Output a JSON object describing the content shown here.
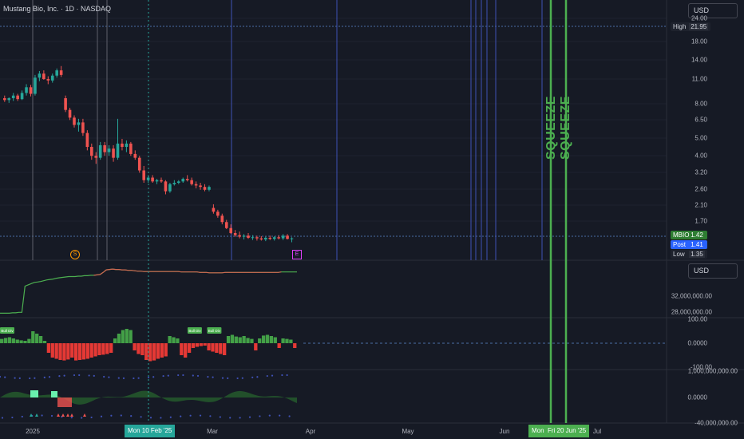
{
  "header": {
    "symbol_title": "Mustang Bio, Inc. · 1D · NASDAQ"
  },
  "currency": "USD",
  "price_axis": [
    "24.00",
    "18.00",
    "14.00",
    "11.00",
    "8.00",
    "6.50",
    "5.00",
    "4.00",
    "3.20",
    "2.60",
    "2.10",
    "1.70"
  ],
  "volume_axis": [
    "32,000,000.00",
    "28,000,000.00"
  ],
  "osc_axis": [
    "100.00",
    "0.0000",
    "-100.00"
  ],
  "osc2_axis": [
    "1,000,000,000.00",
    "0.0000",
    "-40,000,000.00"
  ],
  "tags": {
    "high": {
      "label": "High",
      "value": "21.95"
    },
    "symbol": {
      "label": "MBIO",
      "value": "1.42"
    },
    "post": {
      "label": "Post",
      "value": "1.41"
    },
    "low": {
      "label": "Low",
      "value": "1.35"
    }
  },
  "time_axis": [
    "2025",
    "Mar",
    "Apr",
    "May",
    "Jun",
    "Jul"
  ],
  "time_highlights": {
    "crosshair": "Mon 10 Feb '25",
    "mon": "Mon",
    "fri": "Fri 20 Jun '25"
  },
  "markers": {
    "dividend": "S",
    "earnings": "E"
  },
  "squeeze_labels": [
    "SQUEEZE",
    "SQUEEZE"
  ],
  "badges": [
    "Bull Div",
    "Bull Div",
    "Bull Div"
  ],
  "colors": {
    "bg": "#161a25",
    "up": "#26a69a",
    "down": "#ef5350",
    "squeeze": "#4caf50",
    "crosshair": "#26a69a",
    "tag_blue": "#2962ff"
  },
  "chart_data": {
    "type": "candlestick",
    "scale": "log",
    "ylim": [
      1.2,
      27
    ],
    "candles": [
      {
        "o": 8.6,
        "h": 8.9,
        "l": 8.2,
        "c": 8.4
      },
      {
        "o": 8.4,
        "h": 8.7,
        "l": 8.1,
        "c": 8.6
      },
      {
        "o": 8.6,
        "h": 9.2,
        "l": 8.3,
        "c": 8.9
      },
      {
        "o": 8.9,
        "h": 9.1,
        "l": 8.3,
        "c": 8.5
      },
      {
        "o": 8.5,
        "h": 9.5,
        "l": 8.4,
        "c": 9.2
      },
      {
        "o": 9.2,
        "h": 10.3,
        "l": 8.9,
        "c": 9.9
      },
      {
        "o": 9.9,
        "h": 10.2,
        "l": 8.8,
        "c": 9.1
      },
      {
        "o": 9.1,
        "h": 11.6,
        "l": 8.9,
        "c": 11.2
      },
      {
        "o": 11.2,
        "h": 12.2,
        "l": 10.7,
        "c": 11.8
      },
      {
        "o": 11.8,
        "h": 12.3,
        "l": 10.9,
        "c": 11.0
      },
      {
        "o": 11.0,
        "h": 11.4,
        "l": 10.3,
        "c": 10.8
      },
      {
        "o": 10.8,
        "h": 11.8,
        "l": 10.5,
        "c": 11.5
      },
      {
        "o": 11.5,
        "h": 12.6,
        "l": 11.2,
        "c": 12.3
      },
      {
        "o": 12.3,
        "h": 13.0,
        "l": 11.3,
        "c": 11.6
      },
      {
        "o": 8.6,
        "h": 8.9,
        "l": 7.2,
        "c": 7.4
      },
      {
        "o": 7.4,
        "h": 7.6,
        "l": 6.5,
        "c": 6.7
      },
      {
        "o": 6.7,
        "h": 6.9,
        "l": 5.9,
        "c": 6.1
      },
      {
        "o": 6.1,
        "h": 6.6,
        "l": 5.6,
        "c": 6.3
      },
      {
        "o": 6.3,
        "h": 6.6,
        "l": 5.3,
        "c": 5.5
      },
      {
        "o": 5.5,
        "h": 5.7,
        "l": 4.4,
        "c": 4.6
      },
      {
        "o": 4.6,
        "h": 4.8,
        "l": 3.9,
        "c": 4.1
      },
      {
        "o": 4.1,
        "h": 4.3,
        "l": 3.7,
        "c": 4.0
      },
      {
        "o": 4.0,
        "h": 4.9,
        "l": 3.9,
        "c": 4.7
      },
      {
        "o": 4.7,
        "h": 4.9,
        "l": 4.1,
        "c": 4.3
      },
      {
        "o": 4.3,
        "h": 4.7,
        "l": 4.1,
        "c": 4.5
      },
      {
        "o": 4.5,
        "h": 4.7,
        "l": 3.8,
        "c": 4.0
      },
      {
        "o": 4.0,
        "h": 6.6,
        "l": 3.9,
        "c": 4.8
      },
      {
        "o": 4.8,
        "h": 5.1,
        "l": 4.4,
        "c": 4.6
      },
      {
        "o": 4.6,
        "h": 5.0,
        "l": 4.3,
        "c": 4.8
      },
      {
        "o": 4.8,
        "h": 4.9,
        "l": 4.1,
        "c": 4.2
      },
      {
        "o": 4.2,
        "h": 4.4,
        "l": 3.9,
        "c": 4.0
      },
      {
        "o": 4.0,
        "h": 4.1,
        "l": 3.3,
        "c": 3.4
      },
      {
        "o": 3.4,
        "h": 3.6,
        "l": 2.9,
        "c": 3.0
      },
      {
        "o": 3.0,
        "h": 3.2,
        "l": 2.9,
        "c": 3.1
      },
      {
        "o": 3.1,
        "h": 3.2,
        "l": 2.9,
        "c": 2.95
      },
      {
        "o": 2.95,
        "h": 3.05,
        "l": 2.85,
        "c": 3.0
      },
      {
        "o": 3.0,
        "h": 3.1,
        "l": 2.9,
        "c": 2.95
      },
      {
        "o": 2.95,
        "h": 3.0,
        "l": 2.5,
        "c": 2.6
      },
      {
        "o": 2.6,
        "h": 2.9,
        "l": 2.55,
        "c": 2.85
      },
      {
        "o": 2.85,
        "h": 3.0,
        "l": 2.8,
        "c": 2.9
      },
      {
        "o": 2.9,
        "h": 3.0,
        "l": 2.85,
        "c": 2.95
      },
      {
        "o": 2.95,
        "h": 3.1,
        "l": 2.9,
        "c": 3.05
      },
      {
        "o": 3.05,
        "h": 3.2,
        "l": 2.95,
        "c": 3.0
      },
      {
        "o": 3.0,
        "h": 3.1,
        "l": 2.8,
        "c": 2.85
      },
      {
        "o": 2.85,
        "h": 2.95,
        "l": 2.7,
        "c": 2.8
      },
      {
        "o": 2.8,
        "h": 2.9,
        "l": 2.65,
        "c": 2.75
      },
      {
        "o": 2.75,
        "h": 2.85,
        "l": 2.6,
        "c": 2.65
      },
      {
        "o": 2.65,
        "h": 2.8,
        "l": 2.6,
        "c": 2.75
      },
      {
        "o": 2.1,
        "h": 2.2,
        "l": 1.95,
        "c": 2.0
      },
      {
        "o": 2.0,
        "h": 2.05,
        "l": 1.85,
        "c": 1.9
      },
      {
        "o": 1.9,
        "h": 1.95,
        "l": 1.7,
        "c": 1.75
      },
      {
        "o": 1.75,
        "h": 1.8,
        "l": 1.6,
        "c": 1.62
      },
      {
        "o": 1.62,
        "h": 1.7,
        "l": 1.5,
        "c": 1.52
      },
      {
        "o": 1.52,
        "h": 1.58,
        "l": 1.45,
        "c": 1.48
      },
      {
        "o": 1.48,
        "h": 1.55,
        "l": 1.42,
        "c": 1.45
      },
      {
        "o": 1.45,
        "h": 1.5,
        "l": 1.4,
        "c": 1.47
      },
      {
        "o": 1.47,
        "h": 1.52,
        "l": 1.41,
        "c": 1.43
      },
      {
        "o": 1.43,
        "h": 1.48,
        "l": 1.39,
        "c": 1.44
      },
      {
        "o": 1.44,
        "h": 1.47,
        "l": 1.38,
        "c": 1.42
      },
      {
        "o": 1.42,
        "h": 1.46,
        "l": 1.38,
        "c": 1.4
      },
      {
        "o": 1.4,
        "h": 1.45,
        "l": 1.37,
        "c": 1.43
      },
      {
        "o": 1.43,
        "h": 1.47,
        "l": 1.39,
        "c": 1.41
      },
      {
        "o": 1.41,
        "h": 1.46,
        "l": 1.38,
        "c": 1.44
      },
      {
        "o": 1.44,
        "h": 1.48,
        "l": 1.4,
        "c": 1.42
      },
      {
        "o": 1.42,
        "h": 1.5,
        "l": 1.39,
        "c": 1.47
      },
      {
        "o": 1.47,
        "h": 1.5,
        "l": 1.4,
        "c": 1.41
      },
      {
        "o": 1.41,
        "h": 1.44,
        "l": 1.35,
        "c": 1.42
      }
    ],
    "volume_line": [
      24.5,
      24.5,
      24.5,
      24.5,
      24.6,
      24.6,
      24.7,
      24.7,
      31.0,
      31.3,
      31.6,
      31.9,
      32.0,
      32.1,
      32.3,
      32.5,
      32.6,
      32.7,
      32.9,
      33.0,
      33.1,
      33.2,
      33.3,
      33.3,
      33.3,
      33.4,
      33.4,
      33.5,
      33.5,
      33.6,
      33.6,
      33.7,
      33.8,
      34.3,
      34.9,
      35.0,
      35.1,
      35.0,
      35.0,
      34.9,
      34.9,
      34.8,
      34.8,
      34.7,
      34.6,
      34.6,
      34.5,
      34.5,
      34.5,
      34.5,
      34.5,
      34.5,
      34.5,
      34.5,
      34.5,
      34.5,
      34.5,
      34.5,
      34.4,
      34.4,
      34.4,
      34.4,
      34.4,
      34.4,
      34.3,
      34.3,
      34.3,
      34.2,
      34.2,
      34.2,
      34.2,
      34.2,
      34.3,
      34.3,
      34.3,
      34.3,
      34.3,
      34.3,
      34.3,
      34.3,
      34.3,
      34.3,
      34.3,
      34.3,
      34.3,
      34.3,
      34.3,
      34.3,
      34.3,
      34.3,
      34.4,
      34.4,
      34.4,
      34.4,
      34.4,
      34.4
    ],
    "histogram": [
      18,
      22,
      25,
      20,
      15,
      12,
      10,
      18,
      50,
      40,
      30,
      10,
      -40,
      -60,
      -65,
      -70,
      -72,
      -68,
      -60,
      -72,
      -70,
      -68,
      -65,
      -60,
      -55,
      -50,
      -48,
      -45,
      -40,
      20,
      40,
      55,
      60,
      55,
      -30,
      -45,
      -50,
      -70,
      -75,
      -72,
      -65,
      -60,
      -55,
      30,
      25,
      20,
      -50,
      -60,
      -40,
      -20,
      -15,
      -12,
      -10,
      -30,
      -35,
      -40,
      -45,
      -50,
      30,
      35,
      28,
      25,
      30,
      22,
      18,
      -30,
      20,
      32,
      35,
      30,
      25,
      -20,
      20,
      18,
      15,
      -20
    ],
    "bull_div_indices": [
      0,
      48,
      53
    ]
  }
}
